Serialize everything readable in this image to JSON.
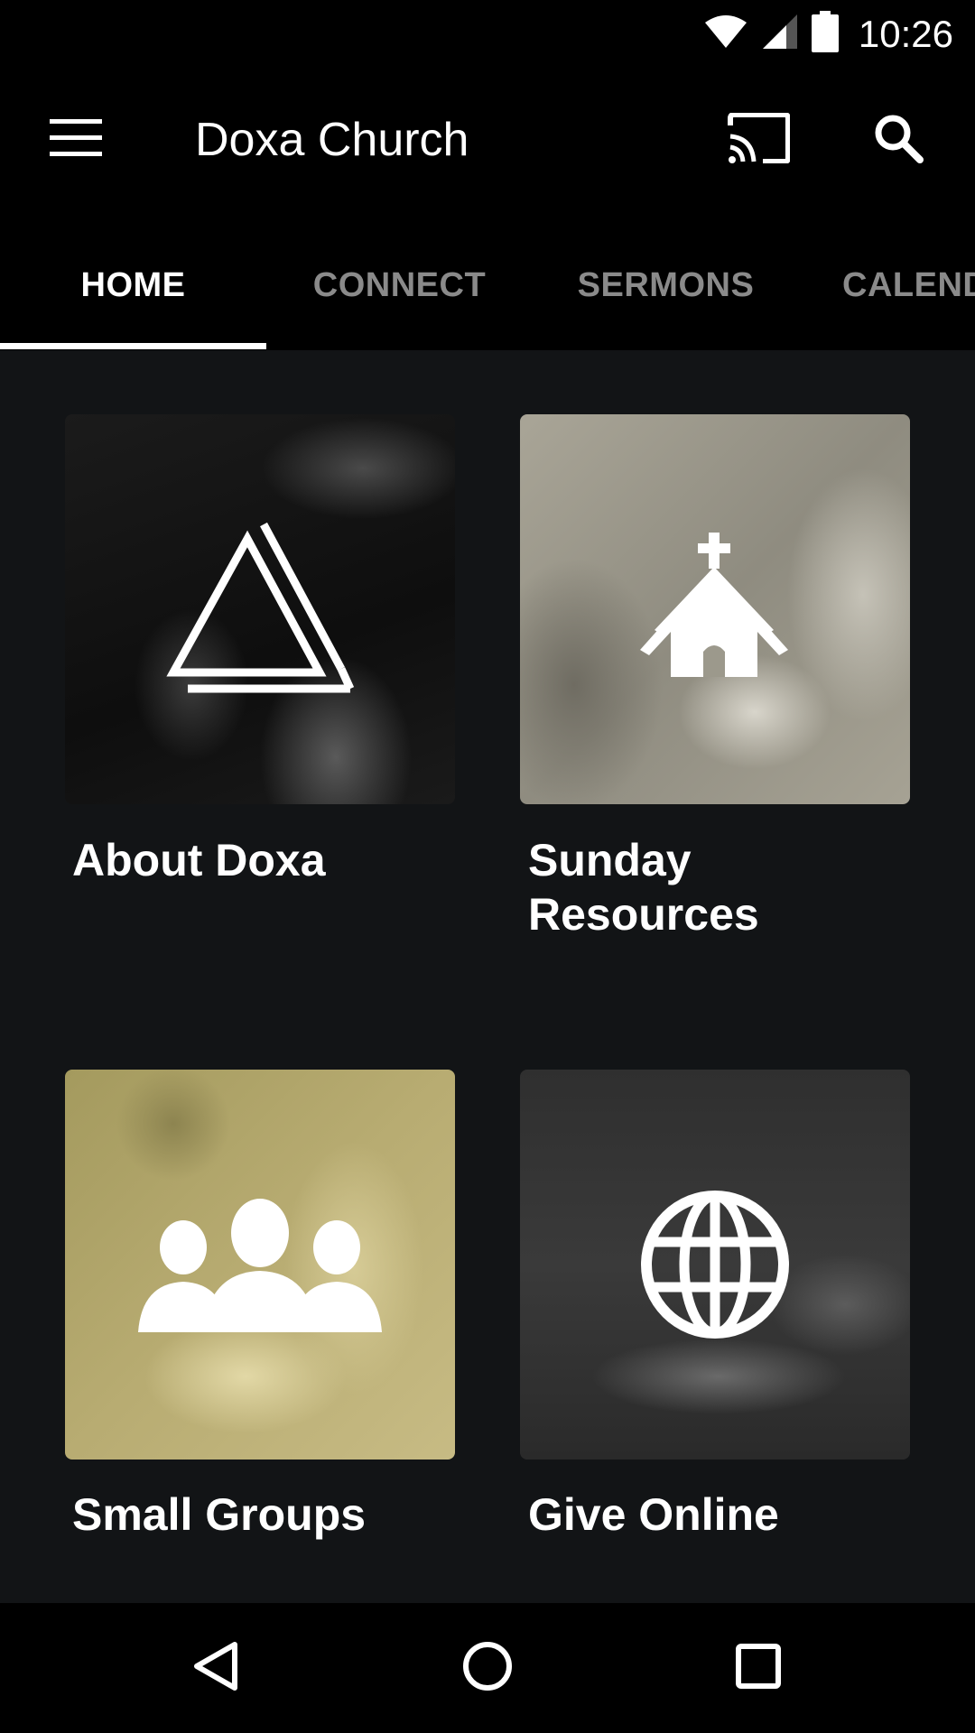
{
  "status_bar": {
    "time": "10:26",
    "icons": [
      "wifi-icon",
      "cell-signal-icon",
      "battery-icon"
    ]
  },
  "app_bar": {
    "title": "Doxa Church",
    "icons": [
      "menu-icon",
      "cast-icon",
      "search-icon"
    ]
  },
  "tabs": [
    {
      "label": "HOME",
      "active": true
    },
    {
      "label": "CONNECT",
      "active": false
    },
    {
      "label": "SERMONS",
      "active": false
    },
    {
      "label": "CALENDAR",
      "active": false
    }
  ],
  "tiles": [
    {
      "label": "About Doxa",
      "icon": "triangle-logo-icon",
      "tint": "#1a1a1a"
    },
    {
      "label": "Sunday Resources",
      "icon": "church-icon",
      "tint": "#9b978a"
    },
    {
      "label": "Small Groups",
      "icon": "people-group-icon",
      "tint": "#b8ac72"
    },
    {
      "label": "Give Online",
      "icon": "globe-icon",
      "tint": "#3a3a3a"
    }
  ],
  "nav_bar": {
    "icons": [
      "back-icon",
      "home-circle-icon",
      "recents-icon"
    ]
  },
  "colors": {
    "bar_background": "#000000",
    "content_background": "#121416",
    "tab_inactive": "#8a8a8a",
    "text_primary": "#ffffff"
  }
}
